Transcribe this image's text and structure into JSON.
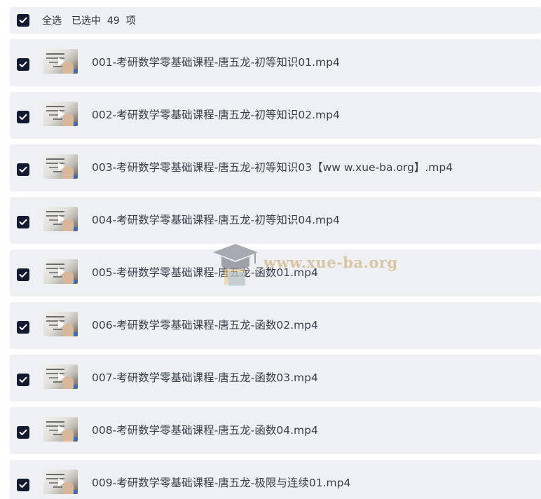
{
  "header": {
    "select_all_label": "全选",
    "selected_text": "已选中  49  项",
    "checked": true
  },
  "files": [
    {
      "name": "001-考研数学零基础课程-唐五龙-初等知识01.mp4",
      "checked": true
    },
    {
      "name": "002-考研数学零基础课程-唐五龙-初等知识02.mp4",
      "checked": true
    },
    {
      "name": "003-考研数学零基础课程-唐五龙-初等知识03【ww w.xue-ba.org】.mp4",
      "checked": true
    },
    {
      "name": "004-考研数学零基础课程-唐五龙-初等知识04.mp4",
      "checked": true
    },
    {
      "name": "005-考研数学零基础课程-唐五龙-函数01.mp4",
      "checked": true
    },
    {
      "name": "006-考研数学零基础课程-唐五龙-函数02.mp4",
      "checked": true
    },
    {
      "name": "007-考研数学零基础课程-唐五龙-函数03.mp4",
      "checked": true
    },
    {
      "name": "008-考研数学零基础课程-唐五龙-函数04.mp4",
      "checked": true
    },
    {
      "name": "009-考研数学零基础课程-唐五龙-极限与连续01.mp4",
      "checked": true
    }
  ],
  "watermark": {
    "text": "www.xue-ba.org",
    "icon": "graduation-cap-icon"
  },
  "colors": {
    "checkbox": "#121a2f",
    "row_background": "#eef0f3",
    "text": "#3a3f4b",
    "watermark": "#d6be96"
  }
}
